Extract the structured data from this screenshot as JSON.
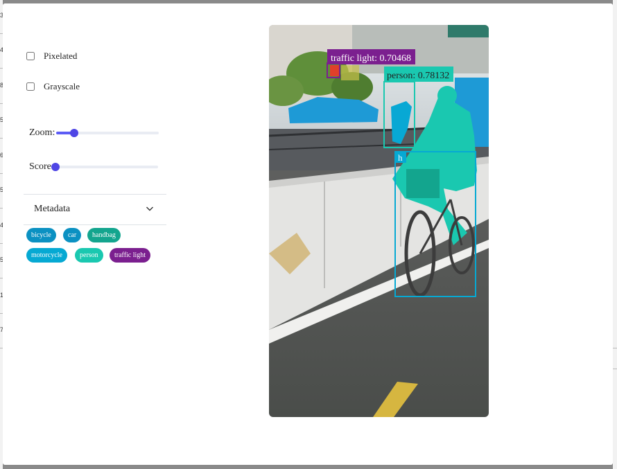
{
  "background": {
    "left_numbers": [
      "3",
      "4",
      "8",
      "5",
      "6",
      "5",
      "4",
      "5",
      "1",
      "7"
    ]
  },
  "controls": {
    "pixelated_label": "Pixelated",
    "grayscale_label": "Grayscale",
    "zoom_label": "Zoom:",
    "score_label": "Score:",
    "zoom_value": 0.17,
    "score_value": 0.0
  },
  "metadata": {
    "title": "Metadata",
    "chevron_icon": "chevron-down-icon"
  },
  "tags": [
    {
      "label": "bicycle",
      "color": "#0b91c2"
    },
    {
      "label": "car",
      "color": "#0b91c2"
    },
    {
      "label": "handbag",
      "color": "#13a58e"
    },
    {
      "label": "motorcycle",
      "color": "#06a9d3"
    },
    {
      "label": "person",
      "color": "#1ac8b0"
    },
    {
      "label": "traffic light",
      "color": "#7b1f8f"
    }
  ],
  "detections": [
    {
      "label": "traffic light: 0.70468",
      "color": "#7b1f8f"
    },
    {
      "label": "person: 0.78132",
      "color": "#1ac8b0"
    },
    {
      "label": "h",
      "color": "#06a9d3"
    }
  ]
}
